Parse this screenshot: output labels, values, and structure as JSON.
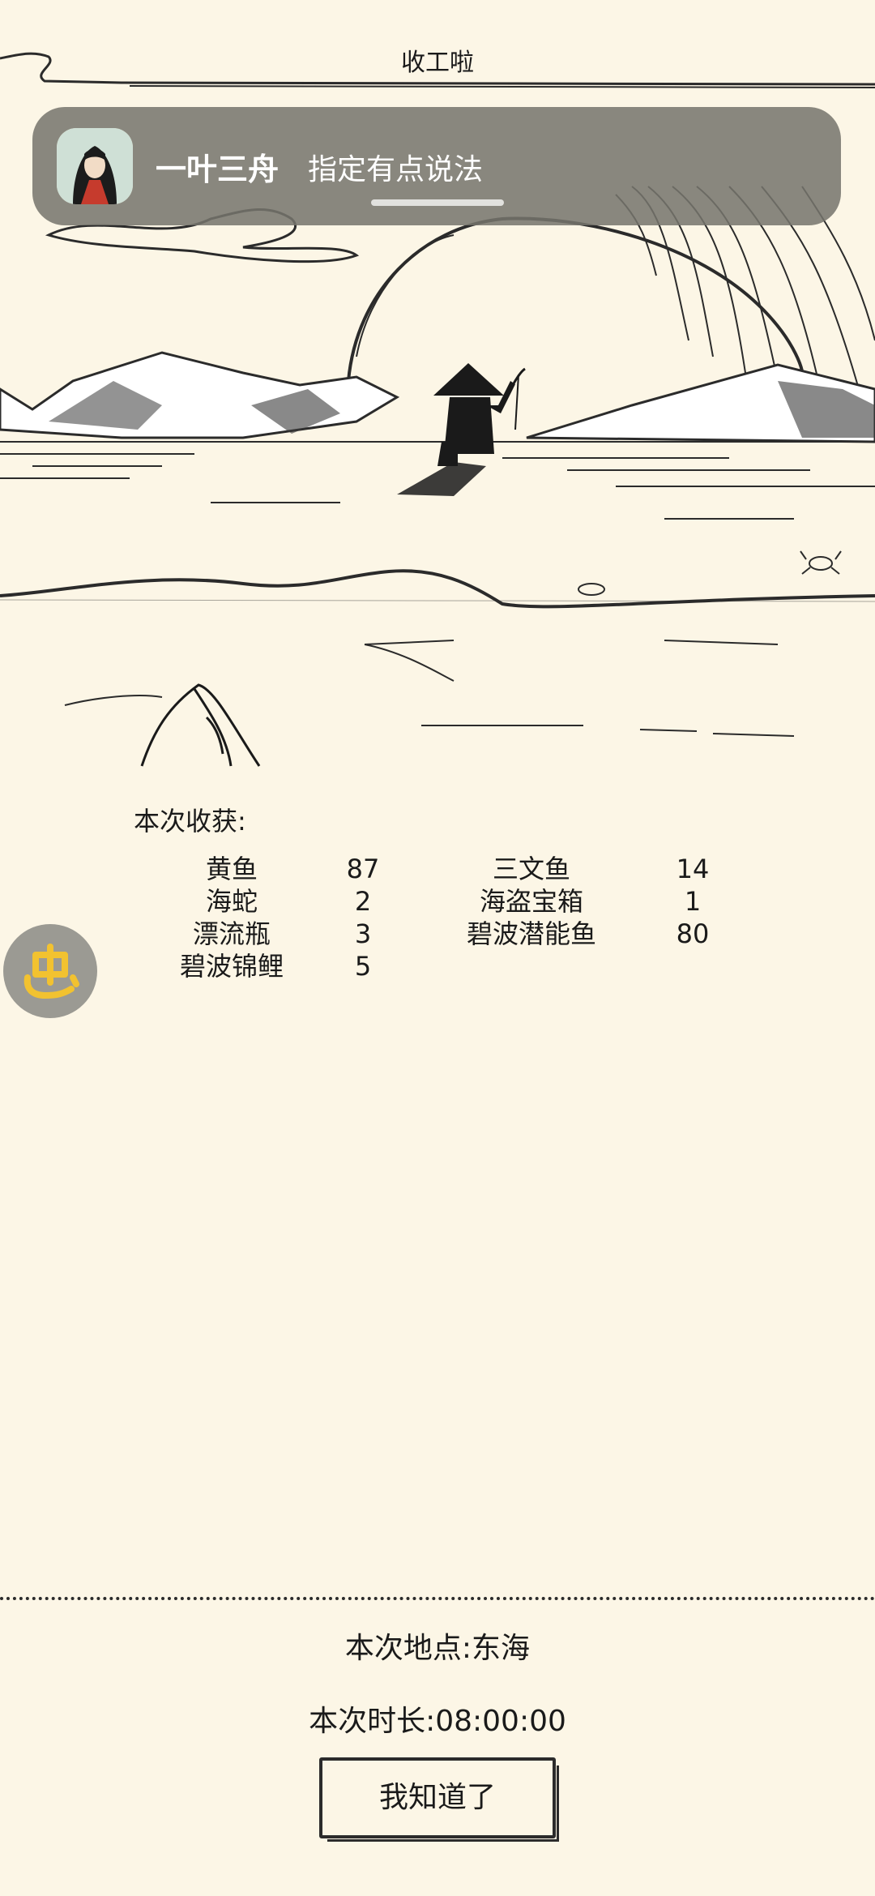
{
  "page": {
    "title": "收工啦"
  },
  "notification": {
    "sender": "一叶三舟",
    "message": "指定有点说法",
    "avatar_icon": "app-avatar-icon"
  },
  "harvest": {
    "title": "本次收获:",
    "left_column": [
      {
        "name": "黄鱼",
        "count": "87"
      },
      {
        "name": "海蛇",
        "count": "2"
      },
      {
        "name": "漂流瓶",
        "count": "3"
      },
      {
        "name": "碧波锦鲤",
        "count": "5"
      }
    ],
    "right_column": [
      {
        "name": "三文鱼",
        "count": "14"
      },
      {
        "name": "海盗宝箱",
        "count": "1"
      },
      {
        "name": "碧波潜能鱼",
        "count": "80"
      }
    ]
  },
  "floating_button": {
    "icon": "bug-icon",
    "color": "#f2c230"
  },
  "summary": {
    "location": "本次地点:东海",
    "duration": "本次时长:08:00:00"
  },
  "confirm_button": {
    "label": "我知道了"
  }
}
